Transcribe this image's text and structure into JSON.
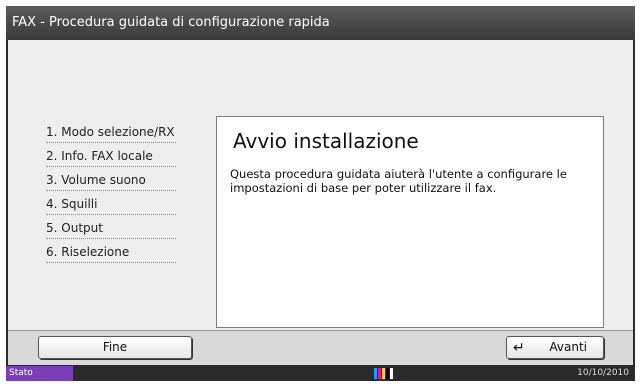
{
  "window": {
    "title": "FAX - Procedura guidata di configurazione rapida"
  },
  "steps": [
    {
      "label": "1. Modo selezione/RX"
    },
    {
      "label": "2. Info. FAX locale"
    },
    {
      "label": "3. Volume suono"
    },
    {
      "label": "4. Squilli"
    },
    {
      "label": "5. Output"
    },
    {
      "label": "6. Riselezione"
    }
  ],
  "content": {
    "heading": "Avvio installazione",
    "body": "Questa procedura guidata aiuterà l'utente a configurare le impostazioni di base per poter utilizzare il fax."
  },
  "buttons": {
    "finish_label": "Fine",
    "next_label": "Avanti",
    "next_icon": "enter-icon"
  },
  "status": {
    "label": "Stato",
    "date": "10/10/2010",
    "toner_colors": [
      "#00aaff",
      "#ff00aa",
      "#ffdd00",
      "#000000",
      "#ffffff"
    ],
    "accent_color": "#7a3fb8"
  }
}
